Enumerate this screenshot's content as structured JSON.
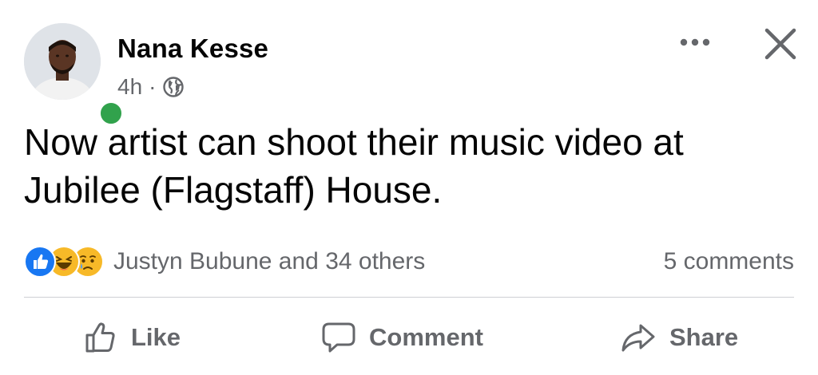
{
  "post": {
    "author": "Nana Kesse",
    "time": "4h",
    "separator": "·",
    "privacy_icon": "globe-icon",
    "online": true,
    "text": "Now artist can shoot their music video at Jubilee (Flagstaff) House.",
    "reactions": {
      "icons": [
        "like-reaction-icon",
        "haha-reaction-icon",
        "sad-reaction-icon"
      ],
      "summary": "Justyn Bubune and 34 others"
    },
    "comments": "5 comments"
  },
  "actions": {
    "like": "Like",
    "comment": "Comment",
    "share": "Share"
  },
  "colors": {
    "primary_text": "#050505",
    "secondary_text": "#65676b",
    "online_green": "#31a24c",
    "like_blue": "#1877f2",
    "reaction_yellow": "#f7b928",
    "divider": "#ced0d4"
  }
}
